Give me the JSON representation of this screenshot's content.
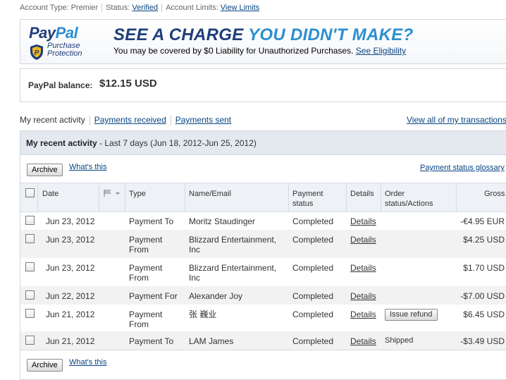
{
  "status_bar": {
    "account_type": "Account Type: Premier",
    "status_label": "Status:",
    "status_value": "Verified",
    "limits_label": "Account Limits:",
    "limits_link": "View Limits"
  },
  "banner": {
    "logo_pay": "Pay",
    "logo_pal": "Pal",
    "logo_sub1": "Purchase",
    "logo_sub2": "Protection",
    "headline_part1": "SEE A CHARGE",
    "headline_part2": "YOU DIDN'T MAKE?",
    "subline": "You may be covered by $0 Liability for Unauthorized Purchases.",
    "eligibility_link": "See Eligibility"
  },
  "balance": {
    "label": "PayPal balance:",
    "amount": "$12.15 USD"
  },
  "tabs": {
    "recent": "My recent activity",
    "received": "Payments received",
    "sent": "Payments sent",
    "view_all": "View all of my transactions"
  },
  "panel": {
    "title": "My recent activity",
    "range": " - Last 7 days (Jun 18, 2012-Jun 25, 2012)",
    "archive": "Archive",
    "whats_this": "What's this",
    "glossary": "Payment status glossary"
  },
  "table": {
    "headers": {
      "date": "Date",
      "type": "Type",
      "name": "Name/Email",
      "status1": "Payment",
      "status2": "status",
      "details": "Details",
      "order1": "Order",
      "order2": "status/Actions",
      "gross": "Gross"
    },
    "rows": [
      {
        "date": "Jun 23, 2012",
        "type1": "Payment To",
        "type2": "",
        "name1": "Moritz Staudinger",
        "name2": "",
        "status": "Completed",
        "details": "Details",
        "action": "",
        "gross": "-€4.95 EUR"
      },
      {
        "date": "Jun 23, 2012",
        "type1": "Payment",
        "type2": "From",
        "name1": "Blizzard Entertainment,",
        "name2": "Inc",
        "status": "Completed",
        "details": "Details",
        "action": "",
        "gross": "$4.25 USD"
      },
      {
        "date": "Jun 23, 2012",
        "type1": "Payment",
        "type2": "From",
        "name1": "Blizzard Entertainment,",
        "name2": "Inc",
        "status": "Completed",
        "details": "Details",
        "action": "",
        "gross": "$1.70 USD"
      },
      {
        "date": "Jun 22, 2012",
        "type1": "Payment For",
        "type2": "",
        "name1": "Alexander Joy",
        "name2": "",
        "status": "Completed",
        "details": "Details",
        "action": "",
        "gross": "-$7.00 USD"
      },
      {
        "date": "Jun 21, 2012",
        "type1": "Payment",
        "type2": "From",
        "name1": "张 巍业",
        "name2": "",
        "status": "Completed",
        "details": "Details",
        "action": "Issue refund",
        "gross": "$6.45 USD"
      },
      {
        "date": "Jun 21, 2012",
        "type1": "Payment To",
        "type2": "",
        "name1": "LAM James",
        "name2": "",
        "status": "Completed",
        "details": "Details",
        "action": "Shipped",
        "gross": "-$3.49 USD"
      }
    ]
  },
  "colors": {
    "link": "#084482",
    "brand_dark": "#1f3e7a",
    "brand_light": "#2c8fd0",
    "panel_header": "#e3e9ef"
  }
}
